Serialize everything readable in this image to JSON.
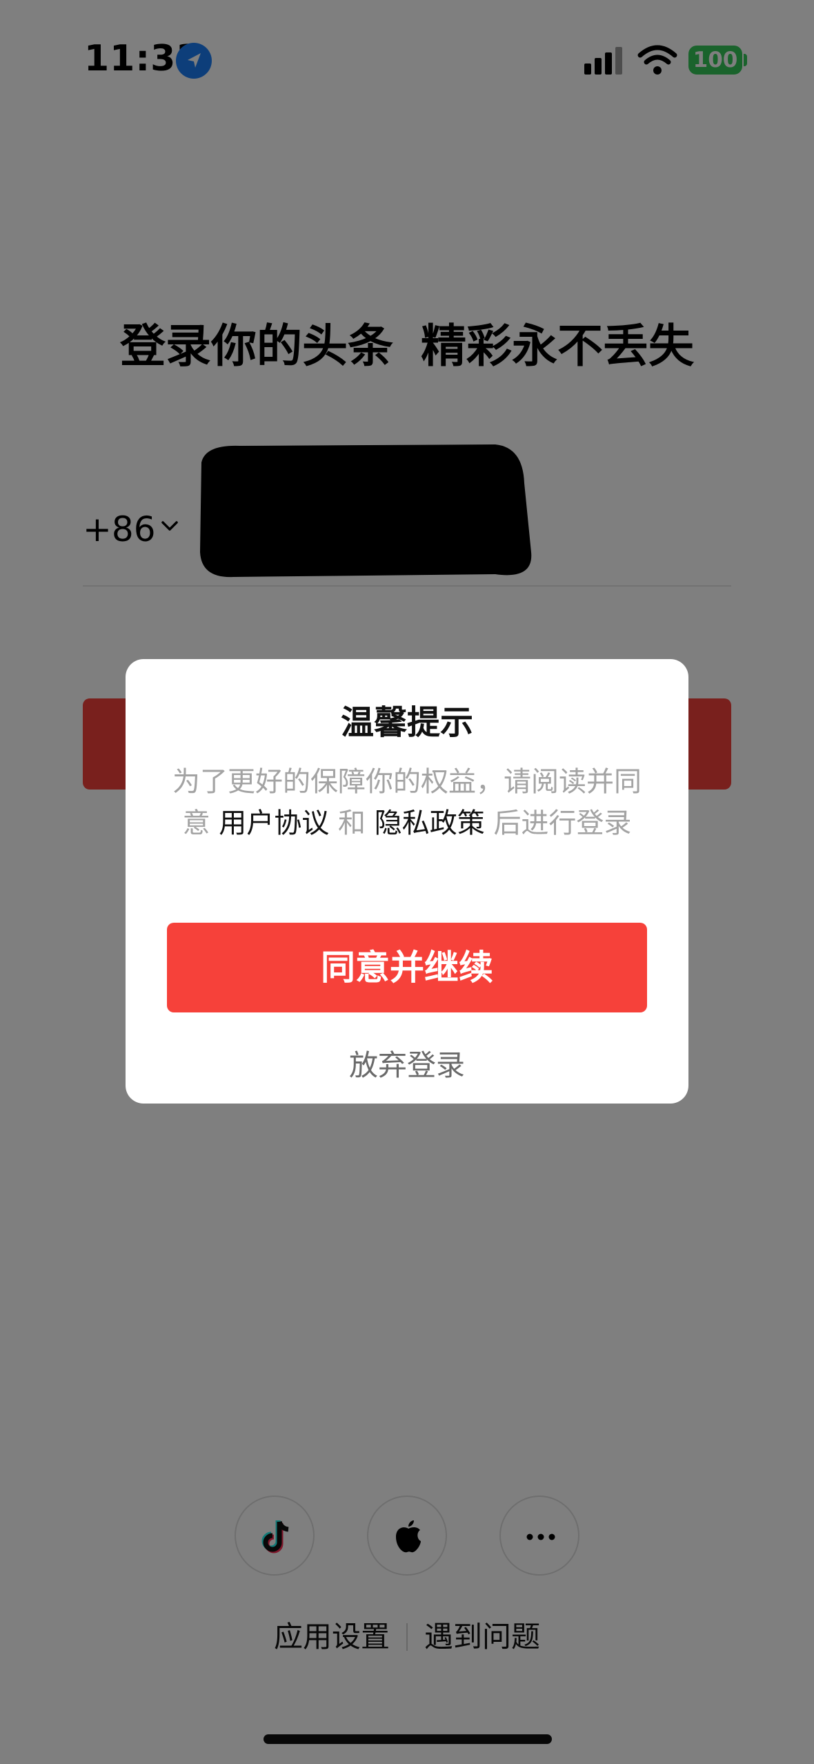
{
  "status_bar": {
    "time": "11:33",
    "battery": "100",
    "icons": [
      "location-arrow-icon",
      "cellular-signal-icon",
      "wifi-icon",
      "battery-icon"
    ]
  },
  "login": {
    "headline_part1": "登录你的头条",
    "headline_part2": "精彩永不丢失",
    "country_code": "+86",
    "phone_number_redacted": true,
    "accent_color": "#f3413a"
  },
  "social_login": {
    "items": [
      {
        "name": "tiktok-icon"
      },
      {
        "name": "apple-icon"
      },
      {
        "name": "more-icon"
      }
    ]
  },
  "footer": {
    "app_settings": "应用设置",
    "help": "遇到问题"
  },
  "dialog": {
    "title": "温馨提示",
    "body_prefix": "为了更好的保障你的权益，请阅读并同意",
    "user_agreement": "用户协议",
    "and": "和",
    "privacy_policy": "隐私政策",
    "body_suffix": "后进行登录",
    "agree_button": "同意并继续",
    "cancel": "放弃登录",
    "button_color": "#f6413a"
  }
}
